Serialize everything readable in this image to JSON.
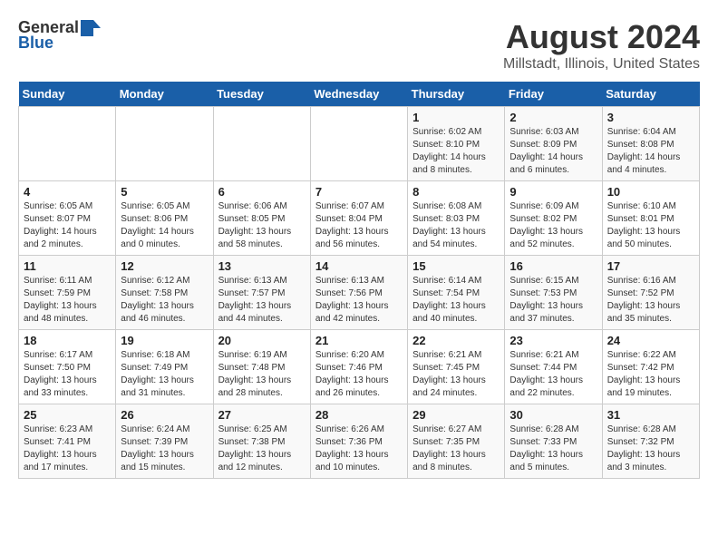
{
  "header": {
    "logo_general": "General",
    "logo_blue": "Blue",
    "title": "August 2024",
    "subtitle": "Millstadt, Illinois, United States"
  },
  "calendar": {
    "days_of_week": [
      "Sunday",
      "Monday",
      "Tuesday",
      "Wednesday",
      "Thursday",
      "Friday",
      "Saturday"
    ],
    "weeks": [
      [
        {
          "day": "",
          "info": ""
        },
        {
          "day": "",
          "info": ""
        },
        {
          "day": "",
          "info": ""
        },
        {
          "day": "",
          "info": ""
        },
        {
          "day": "1",
          "info": "Sunrise: 6:02 AM\nSunset: 8:10 PM\nDaylight: 14 hours\nand 8 minutes."
        },
        {
          "day": "2",
          "info": "Sunrise: 6:03 AM\nSunset: 8:09 PM\nDaylight: 14 hours\nand 6 minutes."
        },
        {
          "day": "3",
          "info": "Sunrise: 6:04 AM\nSunset: 8:08 PM\nDaylight: 14 hours\nand 4 minutes."
        }
      ],
      [
        {
          "day": "4",
          "info": "Sunrise: 6:05 AM\nSunset: 8:07 PM\nDaylight: 14 hours\nand 2 minutes."
        },
        {
          "day": "5",
          "info": "Sunrise: 6:05 AM\nSunset: 8:06 PM\nDaylight: 14 hours\nand 0 minutes."
        },
        {
          "day": "6",
          "info": "Sunrise: 6:06 AM\nSunset: 8:05 PM\nDaylight: 13 hours\nand 58 minutes."
        },
        {
          "day": "7",
          "info": "Sunrise: 6:07 AM\nSunset: 8:04 PM\nDaylight: 13 hours\nand 56 minutes."
        },
        {
          "day": "8",
          "info": "Sunrise: 6:08 AM\nSunset: 8:03 PM\nDaylight: 13 hours\nand 54 minutes."
        },
        {
          "day": "9",
          "info": "Sunrise: 6:09 AM\nSunset: 8:02 PM\nDaylight: 13 hours\nand 52 minutes."
        },
        {
          "day": "10",
          "info": "Sunrise: 6:10 AM\nSunset: 8:01 PM\nDaylight: 13 hours\nand 50 minutes."
        }
      ],
      [
        {
          "day": "11",
          "info": "Sunrise: 6:11 AM\nSunset: 7:59 PM\nDaylight: 13 hours\nand 48 minutes."
        },
        {
          "day": "12",
          "info": "Sunrise: 6:12 AM\nSunset: 7:58 PM\nDaylight: 13 hours\nand 46 minutes."
        },
        {
          "day": "13",
          "info": "Sunrise: 6:13 AM\nSunset: 7:57 PM\nDaylight: 13 hours\nand 44 minutes."
        },
        {
          "day": "14",
          "info": "Sunrise: 6:13 AM\nSunset: 7:56 PM\nDaylight: 13 hours\nand 42 minutes."
        },
        {
          "day": "15",
          "info": "Sunrise: 6:14 AM\nSunset: 7:54 PM\nDaylight: 13 hours\nand 40 minutes."
        },
        {
          "day": "16",
          "info": "Sunrise: 6:15 AM\nSunset: 7:53 PM\nDaylight: 13 hours\nand 37 minutes."
        },
        {
          "day": "17",
          "info": "Sunrise: 6:16 AM\nSunset: 7:52 PM\nDaylight: 13 hours\nand 35 minutes."
        }
      ],
      [
        {
          "day": "18",
          "info": "Sunrise: 6:17 AM\nSunset: 7:50 PM\nDaylight: 13 hours\nand 33 minutes."
        },
        {
          "day": "19",
          "info": "Sunrise: 6:18 AM\nSunset: 7:49 PM\nDaylight: 13 hours\nand 31 minutes."
        },
        {
          "day": "20",
          "info": "Sunrise: 6:19 AM\nSunset: 7:48 PM\nDaylight: 13 hours\nand 28 minutes."
        },
        {
          "day": "21",
          "info": "Sunrise: 6:20 AM\nSunset: 7:46 PM\nDaylight: 13 hours\nand 26 minutes."
        },
        {
          "day": "22",
          "info": "Sunrise: 6:21 AM\nSunset: 7:45 PM\nDaylight: 13 hours\nand 24 minutes."
        },
        {
          "day": "23",
          "info": "Sunrise: 6:21 AM\nSunset: 7:44 PM\nDaylight: 13 hours\nand 22 minutes."
        },
        {
          "day": "24",
          "info": "Sunrise: 6:22 AM\nSunset: 7:42 PM\nDaylight: 13 hours\nand 19 minutes."
        }
      ],
      [
        {
          "day": "25",
          "info": "Sunrise: 6:23 AM\nSunset: 7:41 PM\nDaylight: 13 hours\nand 17 minutes."
        },
        {
          "day": "26",
          "info": "Sunrise: 6:24 AM\nSunset: 7:39 PM\nDaylight: 13 hours\nand 15 minutes."
        },
        {
          "day": "27",
          "info": "Sunrise: 6:25 AM\nSunset: 7:38 PM\nDaylight: 13 hours\nand 12 minutes."
        },
        {
          "day": "28",
          "info": "Sunrise: 6:26 AM\nSunset: 7:36 PM\nDaylight: 13 hours\nand 10 minutes."
        },
        {
          "day": "29",
          "info": "Sunrise: 6:27 AM\nSunset: 7:35 PM\nDaylight: 13 hours\nand 8 minutes."
        },
        {
          "day": "30",
          "info": "Sunrise: 6:28 AM\nSunset: 7:33 PM\nDaylight: 13 hours\nand 5 minutes."
        },
        {
          "day": "31",
          "info": "Sunrise: 6:28 AM\nSunset: 7:32 PM\nDaylight: 13 hours\nand 3 minutes."
        }
      ]
    ]
  }
}
